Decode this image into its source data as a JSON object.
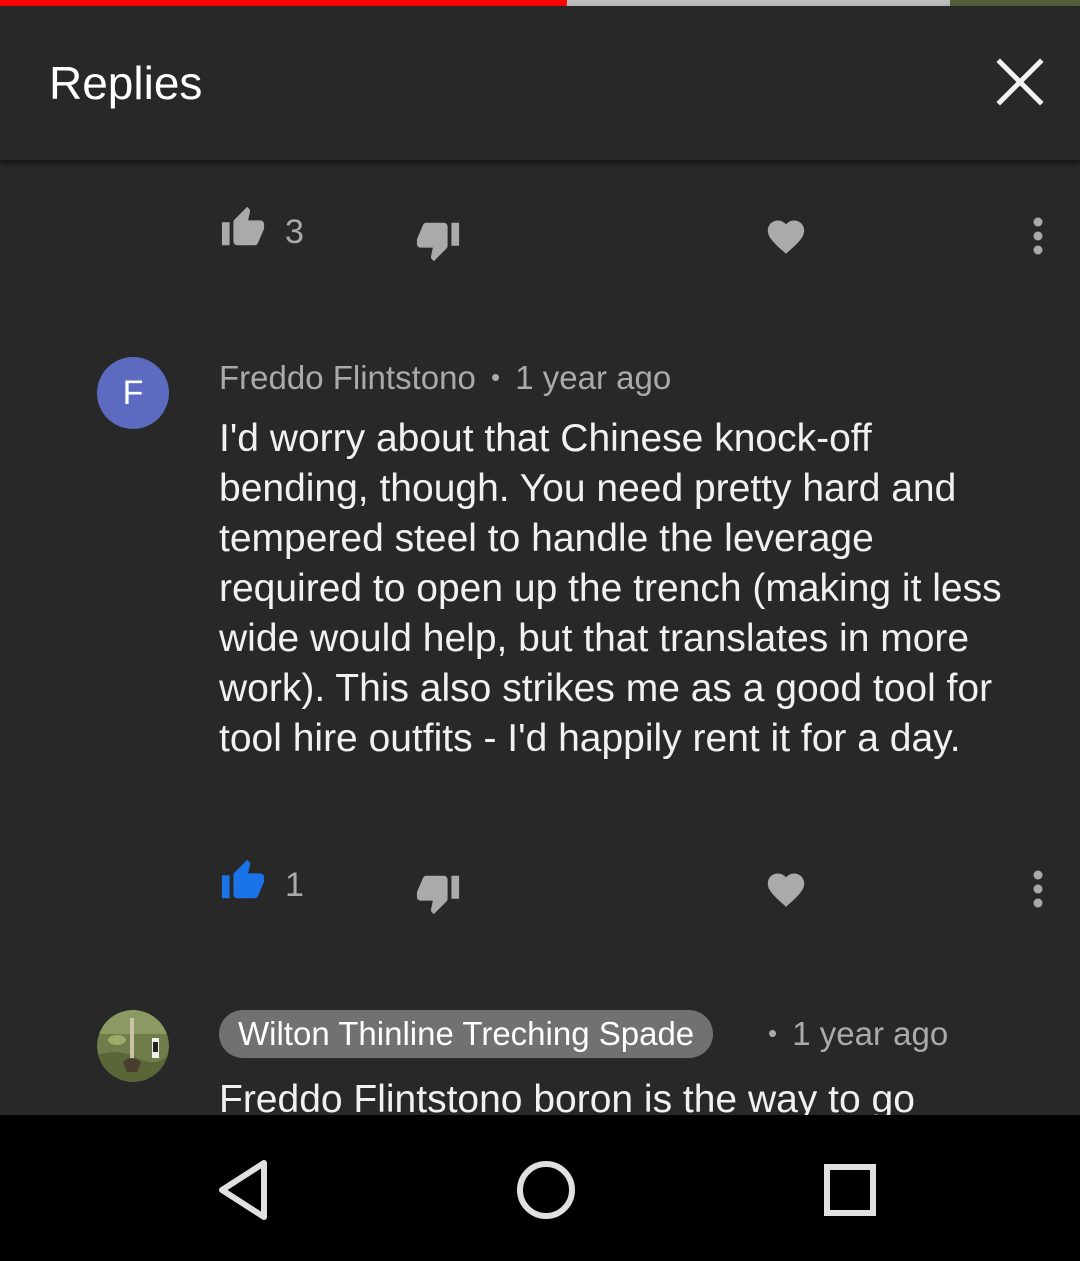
{
  "video": {
    "progress_played": 0.508,
    "progress_buffered": 0.88
  },
  "header": {
    "title": "Replies",
    "close_icon": "close-icon"
  },
  "comments": [
    {
      "likes": "3",
      "liked": false
    },
    {
      "avatar_letter": "F",
      "avatar_color": "#5c6bc0",
      "author": "Freddo Flintstono",
      "time": "1 year ago",
      "text": "I'd worry about that Chinese knock-off bending, though.  You need pretty hard and tempered steel to handle the leverage required to open up the trench (making it less wide would help, but that translates in more work).  This also strikes me as a good tool for tool hire outfits - I'd happily rent it for a day.",
      "likes": "1",
      "liked": true
    },
    {
      "author": "Wilton Thinline Treching Spade",
      "time": "1 year ago",
      "text": "Freddo Flintstono boron is the way to go"
    }
  ],
  "separator": "•",
  "colors": {
    "like_active": "#1a73e8",
    "icon": "#aaaaaa",
    "progress": "#ff0000"
  },
  "navbar": {
    "back": "back-icon",
    "home": "home-icon",
    "recents": "recents-icon"
  }
}
